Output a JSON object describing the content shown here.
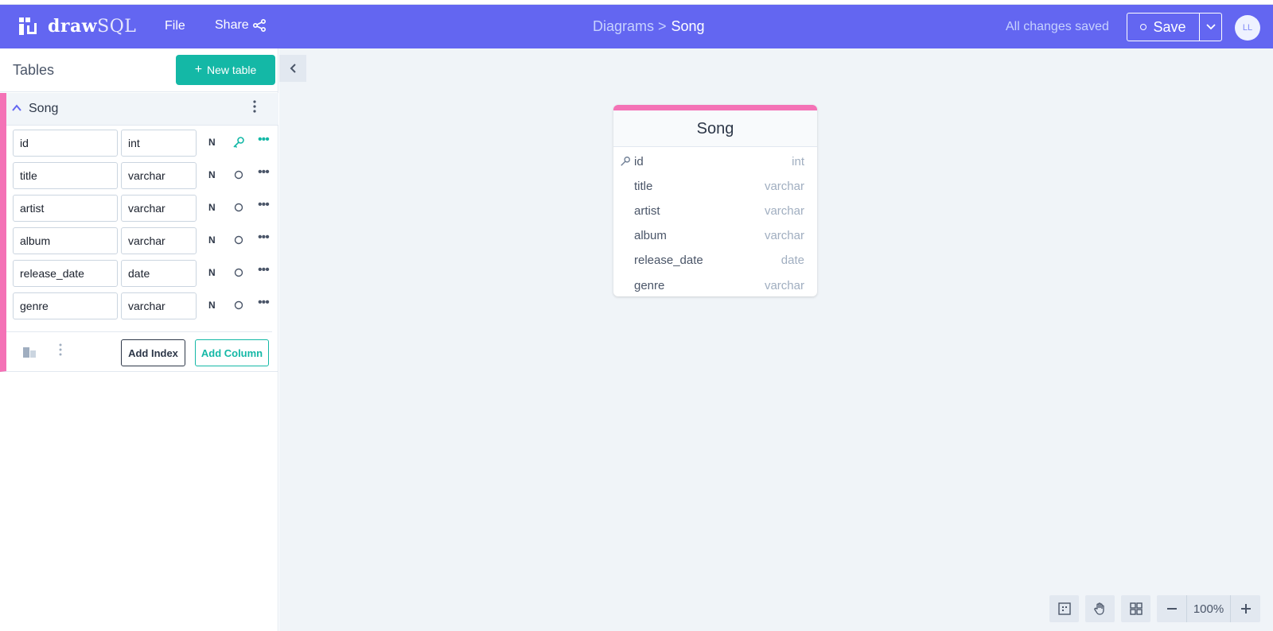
{
  "header": {
    "logo_bold": "draw",
    "logo_light": "SQL",
    "menu_file": "File",
    "menu_share": "Share",
    "breadcrumb_parent": "Diagrams >",
    "breadcrumb_current": "Song",
    "save_status": "All changes saved",
    "save_label": "Save",
    "avatar_initials": "LL"
  },
  "sidebar": {
    "title": "Tables",
    "new_table_label": "New table",
    "table": {
      "name": "Song",
      "columns": [
        {
          "name": "id",
          "type": "int",
          "nullable": "N",
          "primary": true
        },
        {
          "name": "title",
          "type": "varchar",
          "nullable": "N",
          "primary": false
        },
        {
          "name": "artist",
          "type": "varchar",
          "nullable": "N",
          "primary": false
        },
        {
          "name": "album",
          "type": "varchar",
          "nullable": "N",
          "primary": false
        },
        {
          "name": "release_date",
          "type": "date",
          "nullable": "N",
          "primary": false
        },
        {
          "name": "genre",
          "type": "varchar",
          "nullable": "N",
          "primary": false
        }
      ],
      "add_index_label": "Add Index",
      "add_column_label": "Add Column"
    }
  },
  "canvas": {
    "table_title": "Song",
    "rows": [
      {
        "name": "id",
        "type": "int"
      },
      {
        "name": "title",
        "type": "varchar"
      },
      {
        "name": "artist",
        "type": "varchar"
      },
      {
        "name": "album",
        "type": "varchar"
      },
      {
        "name": "release_date",
        "type": "date"
      },
      {
        "name": "genre",
        "type": "varchar"
      }
    ],
    "zoom_level": "100%"
  },
  "colors": {
    "header_bg": "#6366f1",
    "accent_teal": "#14b8a6",
    "table_accent": "#f472b6"
  },
  "icons": [
    "logo-icon",
    "share-icon",
    "chevron-down-icon",
    "chevron-up-icon",
    "more-vertical-icon",
    "key-icon",
    "circle-icon",
    "more-horizontal-icon",
    "chevron-left-icon",
    "plus-icon",
    "minus-icon",
    "grid-icon",
    "hand-icon",
    "select-icon",
    "comment-icon"
  ]
}
